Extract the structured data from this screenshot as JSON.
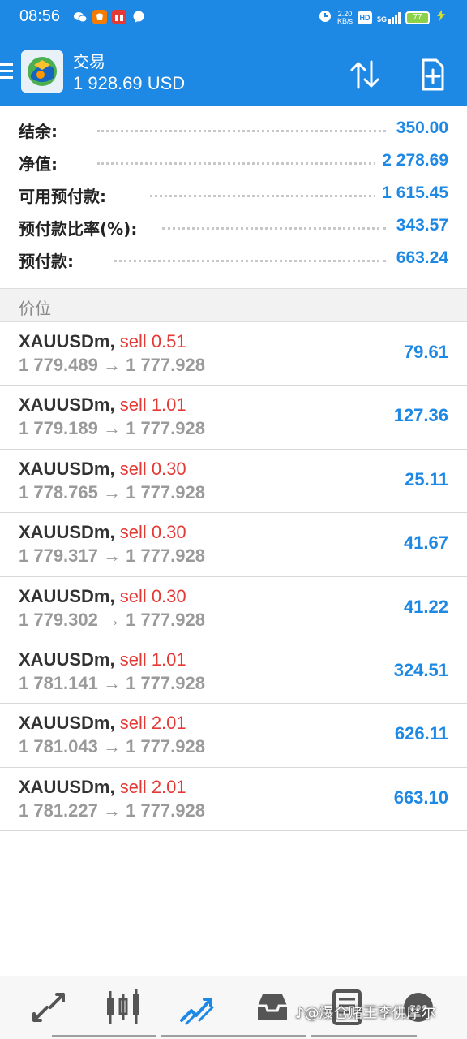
{
  "status_bar": {
    "time": "08:56",
    "net_speed_value": "2.20",
    "net_speed_unit": "KB/s",
    "hd": "HD",
    "signal": "5G",
    "battery": "77"
  },
  "app_bar": {
    "title": "交易",
    "balance": "1 928.69 USD"
  },
  "summary": [
    {
      "label": "结余:",
      "value": "350.00"
    },
    {
      "label": "净值:",
      "value": "2 278.69"
    },
    {
      "label": "可用预付款:",
      "value": "1 615.45"
    },
    {
      "label": "预付款比率(%):",
      "value": "343.57"
    },
    {
      "label": "预付款:",
      "value": "663.24"
    }
  ],
  "section_header": "价位",
  "positions": [
    {
      "symbol": "XAUUSDm,",
      "side": "sell 0.51",
      "prices": "1 779.489 → 1 777.928",
      "profit": "79.61"
    },
    {
      "symbol": "XAUUSDm,",
      "side": "sell 1.01",
      "prices": "1 779.189 → 1 777.928",
      "profit": "127.36"
    },
    {
      "symbol": "XAUUSDm,",
      "side": "sell 0.30",
      "prices": "1 778.765 → 1 777.928",
      "profit": "25.11"
    },
    {
      "symbol": "XAUUSDm,",
      "side": "sell 0.30",
      "prices": "1 779.317 → 1 777.928",
      "profit": "41.67"
    },
    {
      "symbol": "XAUUSDm,",
      "side": "sell 0.30",
      "prices": "1 779.302 → 1 777.928",
      "profit": "41.22"
    },
    {
      "symbol": "XAUUSDm,",
      "side": "sell 1.01",
      "prices": "1 781.141 → 1 777.928",
      "profit": "324.51"
    },
    {
      "symbol": "XAUUSDm,",
      "side": "sell 2.01",
      "prices": "1 781.043 → 1 777.928",
      "profit": "626.11"
    },
    {
      "symbol": "XAUUSDm,",
      "side": "sell 2.01",
      "prices": "1 781.227 → 1 777.928",
      "profit": "663.10"
    }
  ],
  "bottom_nav": {
    "items": [
      "quotes-icon",
      "chart-icon",
      "trade-icon",
      "history-icon",
      "journal-icon",
      "more-icon"
    ],
    "active": "trade-icon"
  },
  "watermark": "@爆仓赌王李佛摩尔",
  "colors": {
    "primary": "#1e88e5",
    "sell": "#e53935",
    "price_grey": "#9a9a9a"
  }
}
